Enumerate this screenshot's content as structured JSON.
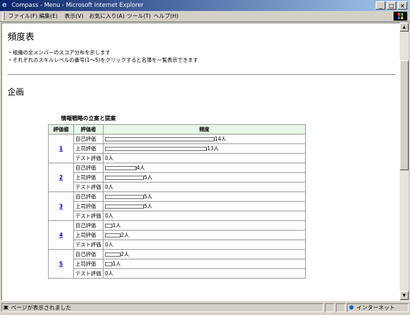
{
  "window": {
    "title": "Compass - Menu - Microsoft Internet Explorer"
  },
  "menu": {
    "items": [
      "ファイル(F)",
      "編集(E)",
      "表示(V)",
      "お気に入り(A)",
      "ツール(T)",
      "ヘルプ(H)"
    ]
  },
  "page": {
    "title": "頻度表",
    "desc1": "・組織の全メンバーのスコア分布を示します",
    "desc2": "・それぞれのスキルレベルの番号(1〜5)をクリックすると名簿を一覧表示できます",
    "section": "企画",
    "caption": "情報戦略の立案と提案",
    "headers": [
      "評価値",
      "評価者",
      "頻度"
    ],
    "max_count": 14,
    "levels": [
      {
        "level": "1",
        "rows": [
          {
            "kind": "自己評価",
            "count": 14,
            "label": "14人"
          },
          {
            "kind": "上司評価",
            "count": 13,
            "label": "13人"
          },
          {
            "kind": "テスト評価",
            "count": 0,
            "label": "0人"
          }
        ]
      },
      {
        "level": "2",
        "rows": [
          {
            "kind": "自己評価",
            "count": 4,
            "label": "4人"
          },
          {
            "kind": "上司評価",
            "count": 5,
            "label": "5人"
          },
          {
            "kind": "テスト評価",
            "count": 0,
            "label": "0人"
          }
        ]
      },
      {
        "level": "3",
        "rows": [
          {
            "kind": "自己評価",
            "count": 5,
            "label": "5人"
          },
          {
            "kind": "上司評価",
            "count": 5,
            "label": "5人"
          },
          {
            "kind": "テスト評価",
            "count": 0,
            "label": "0人"
          }
        ]
      },
      {
        "level": "4",
        "rows": [
          {
            "kind": "自己評価",
            "count": 1,
            "label": "1人"
          },
          {
            "kind": "上司評価",
            "count": 2,
            "label": "2人"
          },
          {
            "kind": "テスト評価",
            "count": 0,
            "label": "0人"
          }
        ]
      },
      {
        "level": "5",
        "rows": [
          {
            "kind": "自己評価",
            "count": 2,
            "label": "2人"
          },
          {
            "kind": "上司評価",
            "count": 1,
            "label": "1人"
          },
          {
            "kind": "テスト評価",
            "count": 0,
            "label": "0人"
          }
        ]
      }
    ]
  },
  "status": {
    "text": "ページが表示されました",
    "zone": "インターネット"
  }
}
